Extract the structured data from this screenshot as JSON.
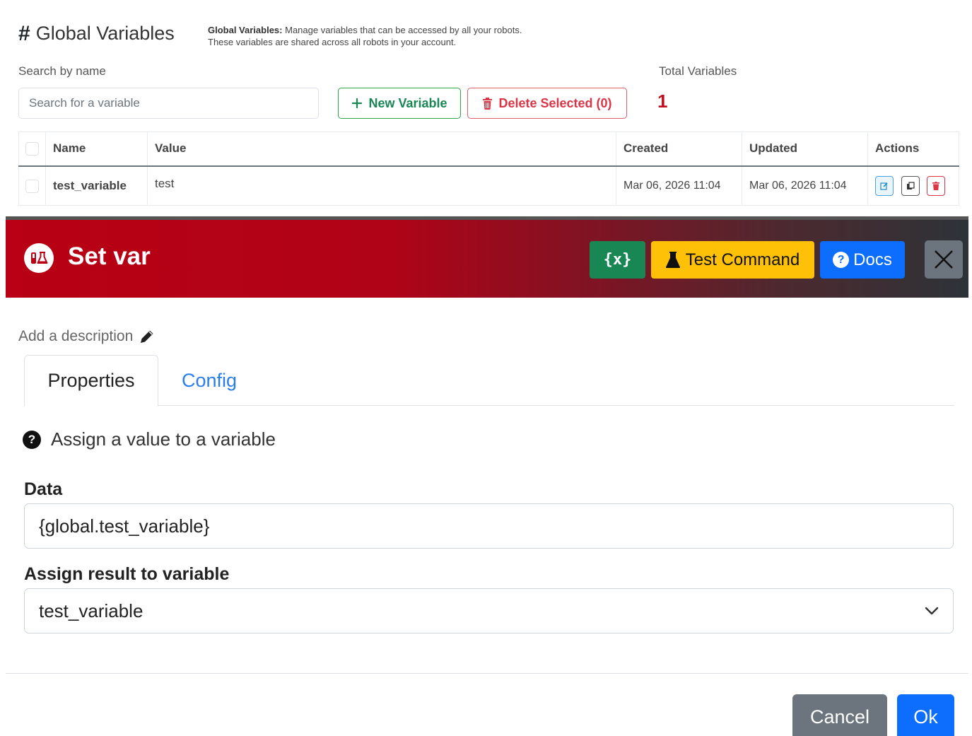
{
  "global_vars": {
    "title": "Global Variables",
    "description_bold": "Global Variables:",
    "description_line1": "Manage variables that can be accessed by all your robots.",
    "description_line2": "These variables are shared across all robots in your account.",
    "search_label": "Search by name",
    "search_placeholder": "Search for a variable",
    "new_button": "New Variable",
    "delete_button": "Delete Selected (0)",
    "total_label": "Total Variables",
    "total_value": "1",
    "columns": [
      "Name",
      "Value",
      "Created",
      "Updated",
      "Actions"
    ],
    "rows": [
      {
        "name": "test_variable",
        "value": "test",
        "created": "Mar 06, 2026 11:04",
        "updated": "Mar 06, 2026 11:04"
      }
    ]
  },
  "modal": {
    "title": "Set var",
    "vars_button": "{x}",
    "test_button": "Test Command",
    "docs_button": "Docs",
    "description_placeholder": "Add a description",
    "tabs": [
      "Properties",
      "Config"
    ],
    "help_text": "Assign a value to a variable",
    "data_label": "Data",
    "data_value": "{global.test_variable}",
    "assign_label": "Assign result to variable",
    "assign_value": "test_variable",
    "cancel_button": "Cancel",
    "ok_button": "Ok"
  },
  "colors": {
    "header_red": "#b90014",
    "primary": "#0d6efd",
    "success": "#198754",
    "warning": "#ffc107",
    "danger": "#dc3545",
    "secondary": "#6c757d"
  },
  "icons": {
    "title": "hash-icon",
    "new": "plus-icon",
    "delete": "trash-icon",
    "modal": "lab-icon",
    "test": "flask-icon",
    "docs": "question-circle-icon",
    "close": "close-icon",
    "description": "pencil-icon",
    "help": "question-circle-icon",
    "select": "chevron-down-icon"
  }
}
